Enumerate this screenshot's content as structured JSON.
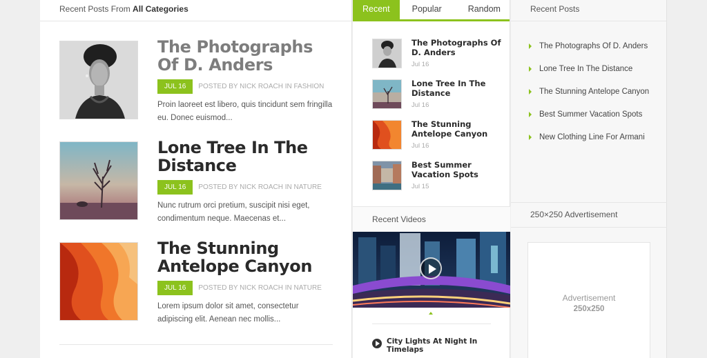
{
  "main": {
    "header_prefix": "Recent Posts From",
    "header_bold": "All Categories",
    "posts": [
      {
        "title": "The Photographs Of D. Anders",
        "date": "JUL 16",
        "byline": "POSTED BY NICK ROACH IN FASHION",
        "excerpt": "Proin laoreet est libero, quis tincidunt sem fringilla eu. Donec euismod..."
      },
      {
        "title": "Lone Tree In The Distance",
        "date": "JUL 16",
        "byline": "POSTED BY NICK ROACH IN NATURE",
        "excerpt": "Nunc rutrum orci pretium, suscipit nisi eget, condimentum neque. Maecenas et..."
      },
      {
        "title": "The Stunning Antelope Canyon",
        "date": "JUL 16",
        "byline": "POSTED BY NICK ROACH IN NATURE",
        "excerpt": "Lorem ipsum dolor sit amet, consectetur adipiscing elit. Aenean nec mollis..."
      }
    ]
  },
  "tabs": {
    "labels": [
      "Recent",
      "Popular",
      "Random"
    ],
    "posts": [
      {
        "title": "The Photographs Of D. Anders",
        "date": "Jul 16"
      },
      {
        "title": "Lone Tree In The Distance",
        "date": "Jul 16"
      },
      {
        "title": "The Stunning Antelope Canyon",
        "date": "Jul 16"
      },
      {
        "title": "Best Summer Vacation Spots",
        "date": "Jul 15"
      }
    ]
  },
  "videos": {
    "header": "Recent Videos",
    "items": [
      {
        "title": "City Lights At Night In Timelaps"
      }
    ]
  },
  "right": {
    "header": "Recent Posts",
    "items": [
      "The Photographs Of D. Anders",
      "Lone Tree In The Distance",
      "The Stunning Antelope Canyon",
      "Best Summer Vacation Spots",
      "New Clothing Line For Armani"
    ],
    "ad_header": "250×250 Advertisement",
    "ad_label": "Advertisement",
    "ad_size": "250x250"
  },
  "colors": {
    "accent": "#8cc21d"
  }
}
